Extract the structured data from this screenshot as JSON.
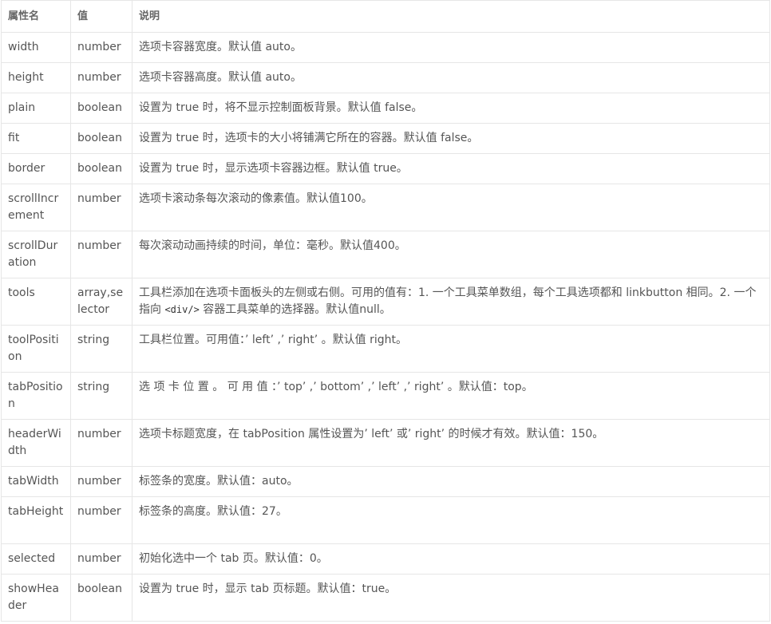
{
  "headers": {
    "name": "属性名",
    "type": "值",
    "desc": "说明"
  },
  "rows": [
    {
      "name": "width",
      "type": "number",
      "desc": "选项卡容器宽度。默认值 auto。"
    },
    {
      "name": "height",
      "type": "number",
      "desc": "选项卡容器高度。默认值 auto。"
    },
    {
      "name": "plain",
      "type": "boolean",
      "desc": "设置为 true 时，将不显示控制面板背景。默认值 false。"
    },
    {
      "name": "fit",
      "type": "boolean",
      "desc": "设置为 true 时，选项卡的大小将铺满它所在的容器。默认值 false。"
    },
    {
      "name": "border",
      "type": "boolean",
      "desc": "设置为 true 时，显示选项卡容器边框。默认值 true。"
    },
    {
      "name": "scrollIncrement",
      "type": "number",
      "desc": "选项卡滚动条每次滚动的像素值。默认值100。"
    },
    {
      "name": "scrollDuration",
      "type": "number",
      "desc": "每次滚动动画持续的时间，单位：毫秒。默认值400。"
    },
    {
      "name": "tools",
      "type": "array,selector",
      "desc_before": "工具栏添加在选项卡面板头的左侧或右侧。可用的值有：1. 一个工具菜单数组，每个工具选项都和 linkbutton 相同。2. 一个指向 ",
      "desc_code": "<div/>",
      "desc_after": " 容器工具菜单的选择器。默认值null。"
    },
    {
      "name": "toolPosition",
      "type": "string",
      "desc": "工具栏位置。可用值：’ left’ ,’ right’ 。默认值 right。"
    },
    {
      "name": "tabPosition",
      "type": "string",
      "desc": "选 项 卡 位 置 。 可 用 值 ：’ top’ ,’ bottom’ ,’ left’ ,’ right’ 。默认值：top。"
    },
    {
      "name": "headerWidth",
      "type": "number",
      "desc": "选项卡标题宽度，在 tabPosition 属性设置为’ left’ 或’ right’ 的时候才有效。默认值：150。"
    },
    {
      "name": "tabWidth",
      "type": "number",
      "desc": "标签条的宽度。默认值：auto。"
    },
    {
      "name": "tabHeight",
      "type": "number",
      "desc": "标签条的高度。默认值：27。"
    },
    {
      "name": "selected",
      "type": "number",
      "desc": "初始化选中一个 tab 页。默认值：0。"
    },
    {
      "name": "showHeader",
      "type": "boolean",
      "desc": "设置为 true 时，显示 tab 页标题。默认值：true。"
    }
  ]
}
